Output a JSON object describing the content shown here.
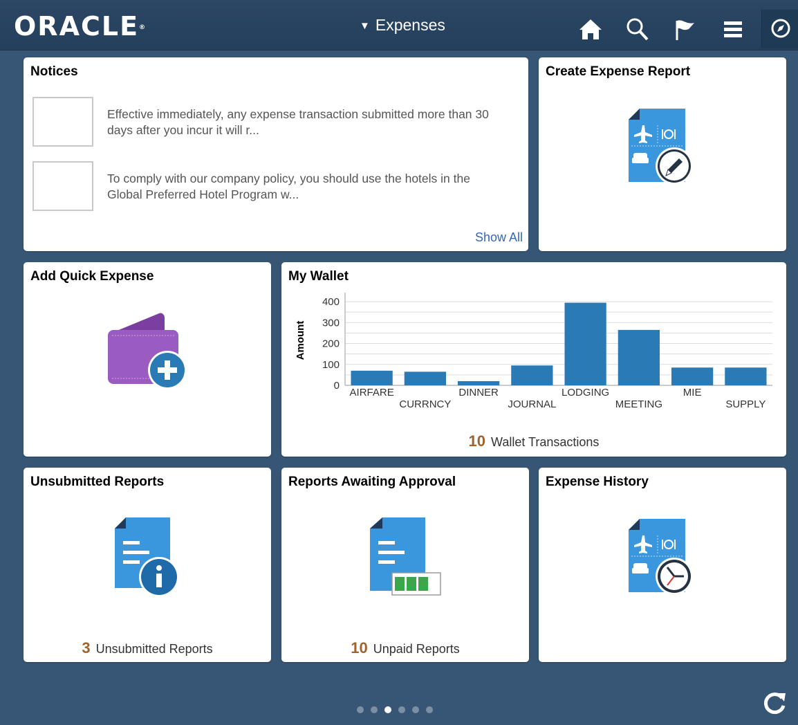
{
  "header": {
    "logo": "ORACLE",
    "title": "Expenses",
    "icons": [
      "home-icon",
      "search-icon",
      "flag-icon",
      "menu-icon",
      "compass-icon"
    ]
  },
  "tiles": {
    "notices": {
      "title": "Notices",
      "items": [
        "Effective immediately, any expense transaction submitted more than 30 days after you incur it will r...",
        "To comply with our company policy, you should use the hotels in the Global Preferred Hotel Program w..."
      ],
      "show_all": "Show All"
    },
    "create_report": {
      "title": "Create Expense Report"
    },
    "quick_expense": {
      "title": "Add Quick Expense"
    },
    "wallet": {
      "title": "My Wallet",
      "count": "10",
      "count_label": "Wallet Transactions"
    },
    "unsubmitted": {
      "title": "Unsubmitted Reports",
      "count": "3",
      "count_label": "Unsubmitted Reports"
    },
    "awaiting": {
      "title": "Reports Awaiting Approval",
      "count": "10",
      "count_label": "Unpaid Reports"
    },
    "history": {
      "title": "Expense History"
    }
  },
  "pager": {
    "total": 6,
    "active_index": 2
  },
  "chart_data": {
    "type": "bar",
    "categories": [
      "AIRFARE",
      "CURRNCY",
      "DINNER",
      "JOURNAL",
      "LODGING",
      "MEETING",
      "MIE",
      "SUPPLY"
    ],
    "values": [
      70,
      65,
      20,
      95,
      395,
      265,
      85,
      85
    ],
    "ylabel": "Amount",
    "yticks": [
      0,
      100,
      200,
      300,
      400
    ],
    "ylim": [
      0,
      430
    ],
    "bar_color": "#2a7ab5",
    "grid": true
  }
}
